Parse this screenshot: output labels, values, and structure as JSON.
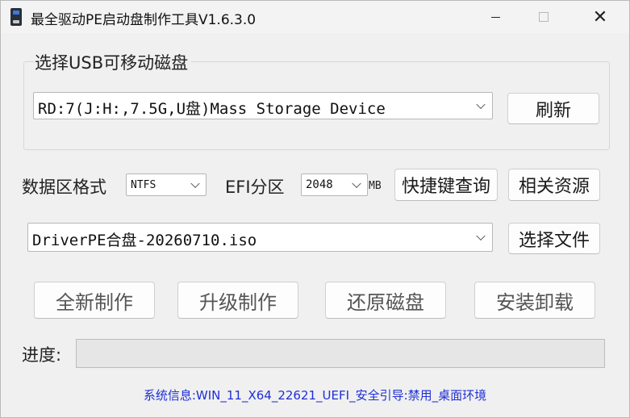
{
  "window": {
    "title": "最全驱动PE启动盘制作工具V1.6.3.0",
    "controls": {
      "minimize": "",
      "maximize": "",
      "close": "✕"
    }
  },
  "usb_group": {
    "label": "选择USB可移动磁盘",
    "device_value": "RD:7(J:H:,7.5G,U盘)Mass Storage Device",
    "refresh_label": "刷新"
  },
  "format": {
    "label": "数据区格式",
    "value": "NTFS",
    "efi_label": "EFI分区",
    "efi_value": "2048",
    "efi_unit": "MB",
    "shortcut_button": "快捷键查询",
    "resources_button": "相关资源"
  },
  "iso": {
    "value": "DriverPE合盘-20260710.iso",
    "select_button": "选择文件"
  },
  "actions": {
    "new_make": "全新制作",
    "upgrade_make": "升级制作",
    "restore_disk": "还原磁盘",
    "install_uninstall": "安装卸载"
  },
  "progress": {
    "label": "进度:",
    "value": 0
  },
  "status": {
    "text": "系统信息:WIN_11_X64_22621_UEFI_安全引导:禁用_桌面环境"
  },
  "colors": {
    "status_text": "#1f2fd6",
    "progress_fill": "#06b025",
    "window_bg": "#f0f0f0"
  },
  "icons": {
    "app": "usb-drive-icon",
    "dropdown": "chevron-down-icon"
  }
}
